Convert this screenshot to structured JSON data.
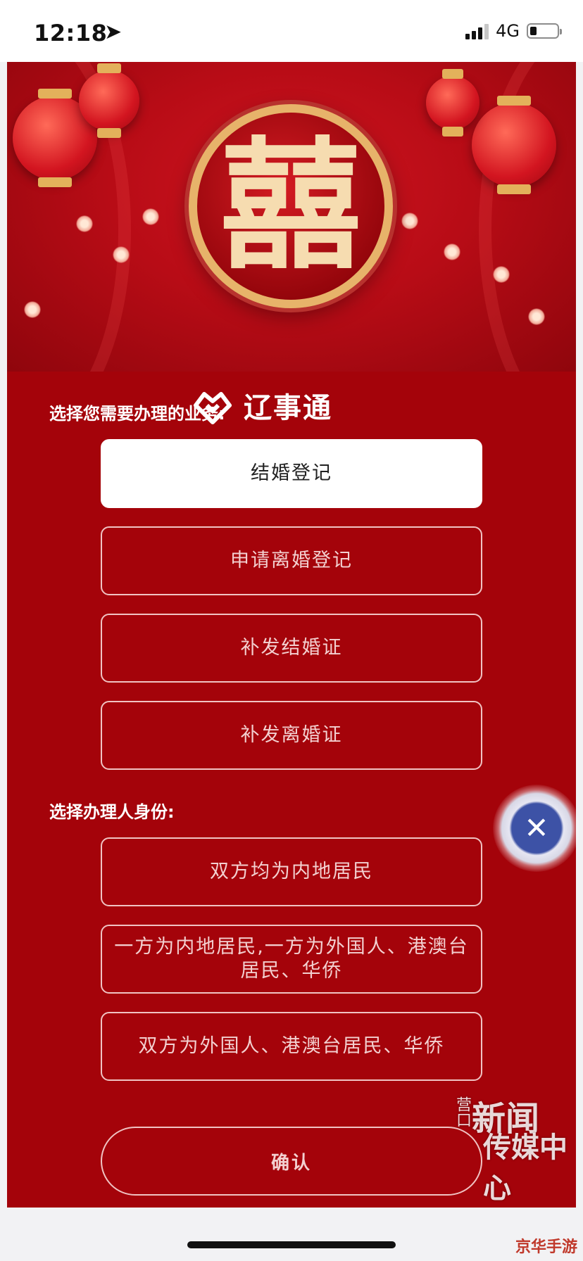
{
  "status_bar": {
    "time": "12:18",
    "network": "4G",
    "battery_level": 0.2
  },
  "banner": {
    "center_char": "囍",
    "app_name": "辽事通"
  },
  "business": {
    "title": "选择您需要办理的业务:",
    "options": [
      "结婚登记",
      "申请离婚登记",
      "补发结婚证",
      "补发离婚证"
    ],
    "selected_index": 0
  },
  "identity": {
    "title": "选择办理人身份:",
    "options": [
      "双方均为内地居民",
      "一方为内地居民,一方为外国人、港澳台居民、华侨",
      "双方为外国人、港澳台居民、华侨"
    ]
  },
  "confirm_label": "确认",
  "close_icon": "close-icon",
  "watermark": {
    "small": "营口",
    "line1": "新闻",
    "line2": "传媒中心"
  },
  "corner_text": "京华手游",
  "colors": {
    "background": "#a4030a",
    "selected_bg": "#ffffff",
    "fab": "#3d52a6"
  }
}
